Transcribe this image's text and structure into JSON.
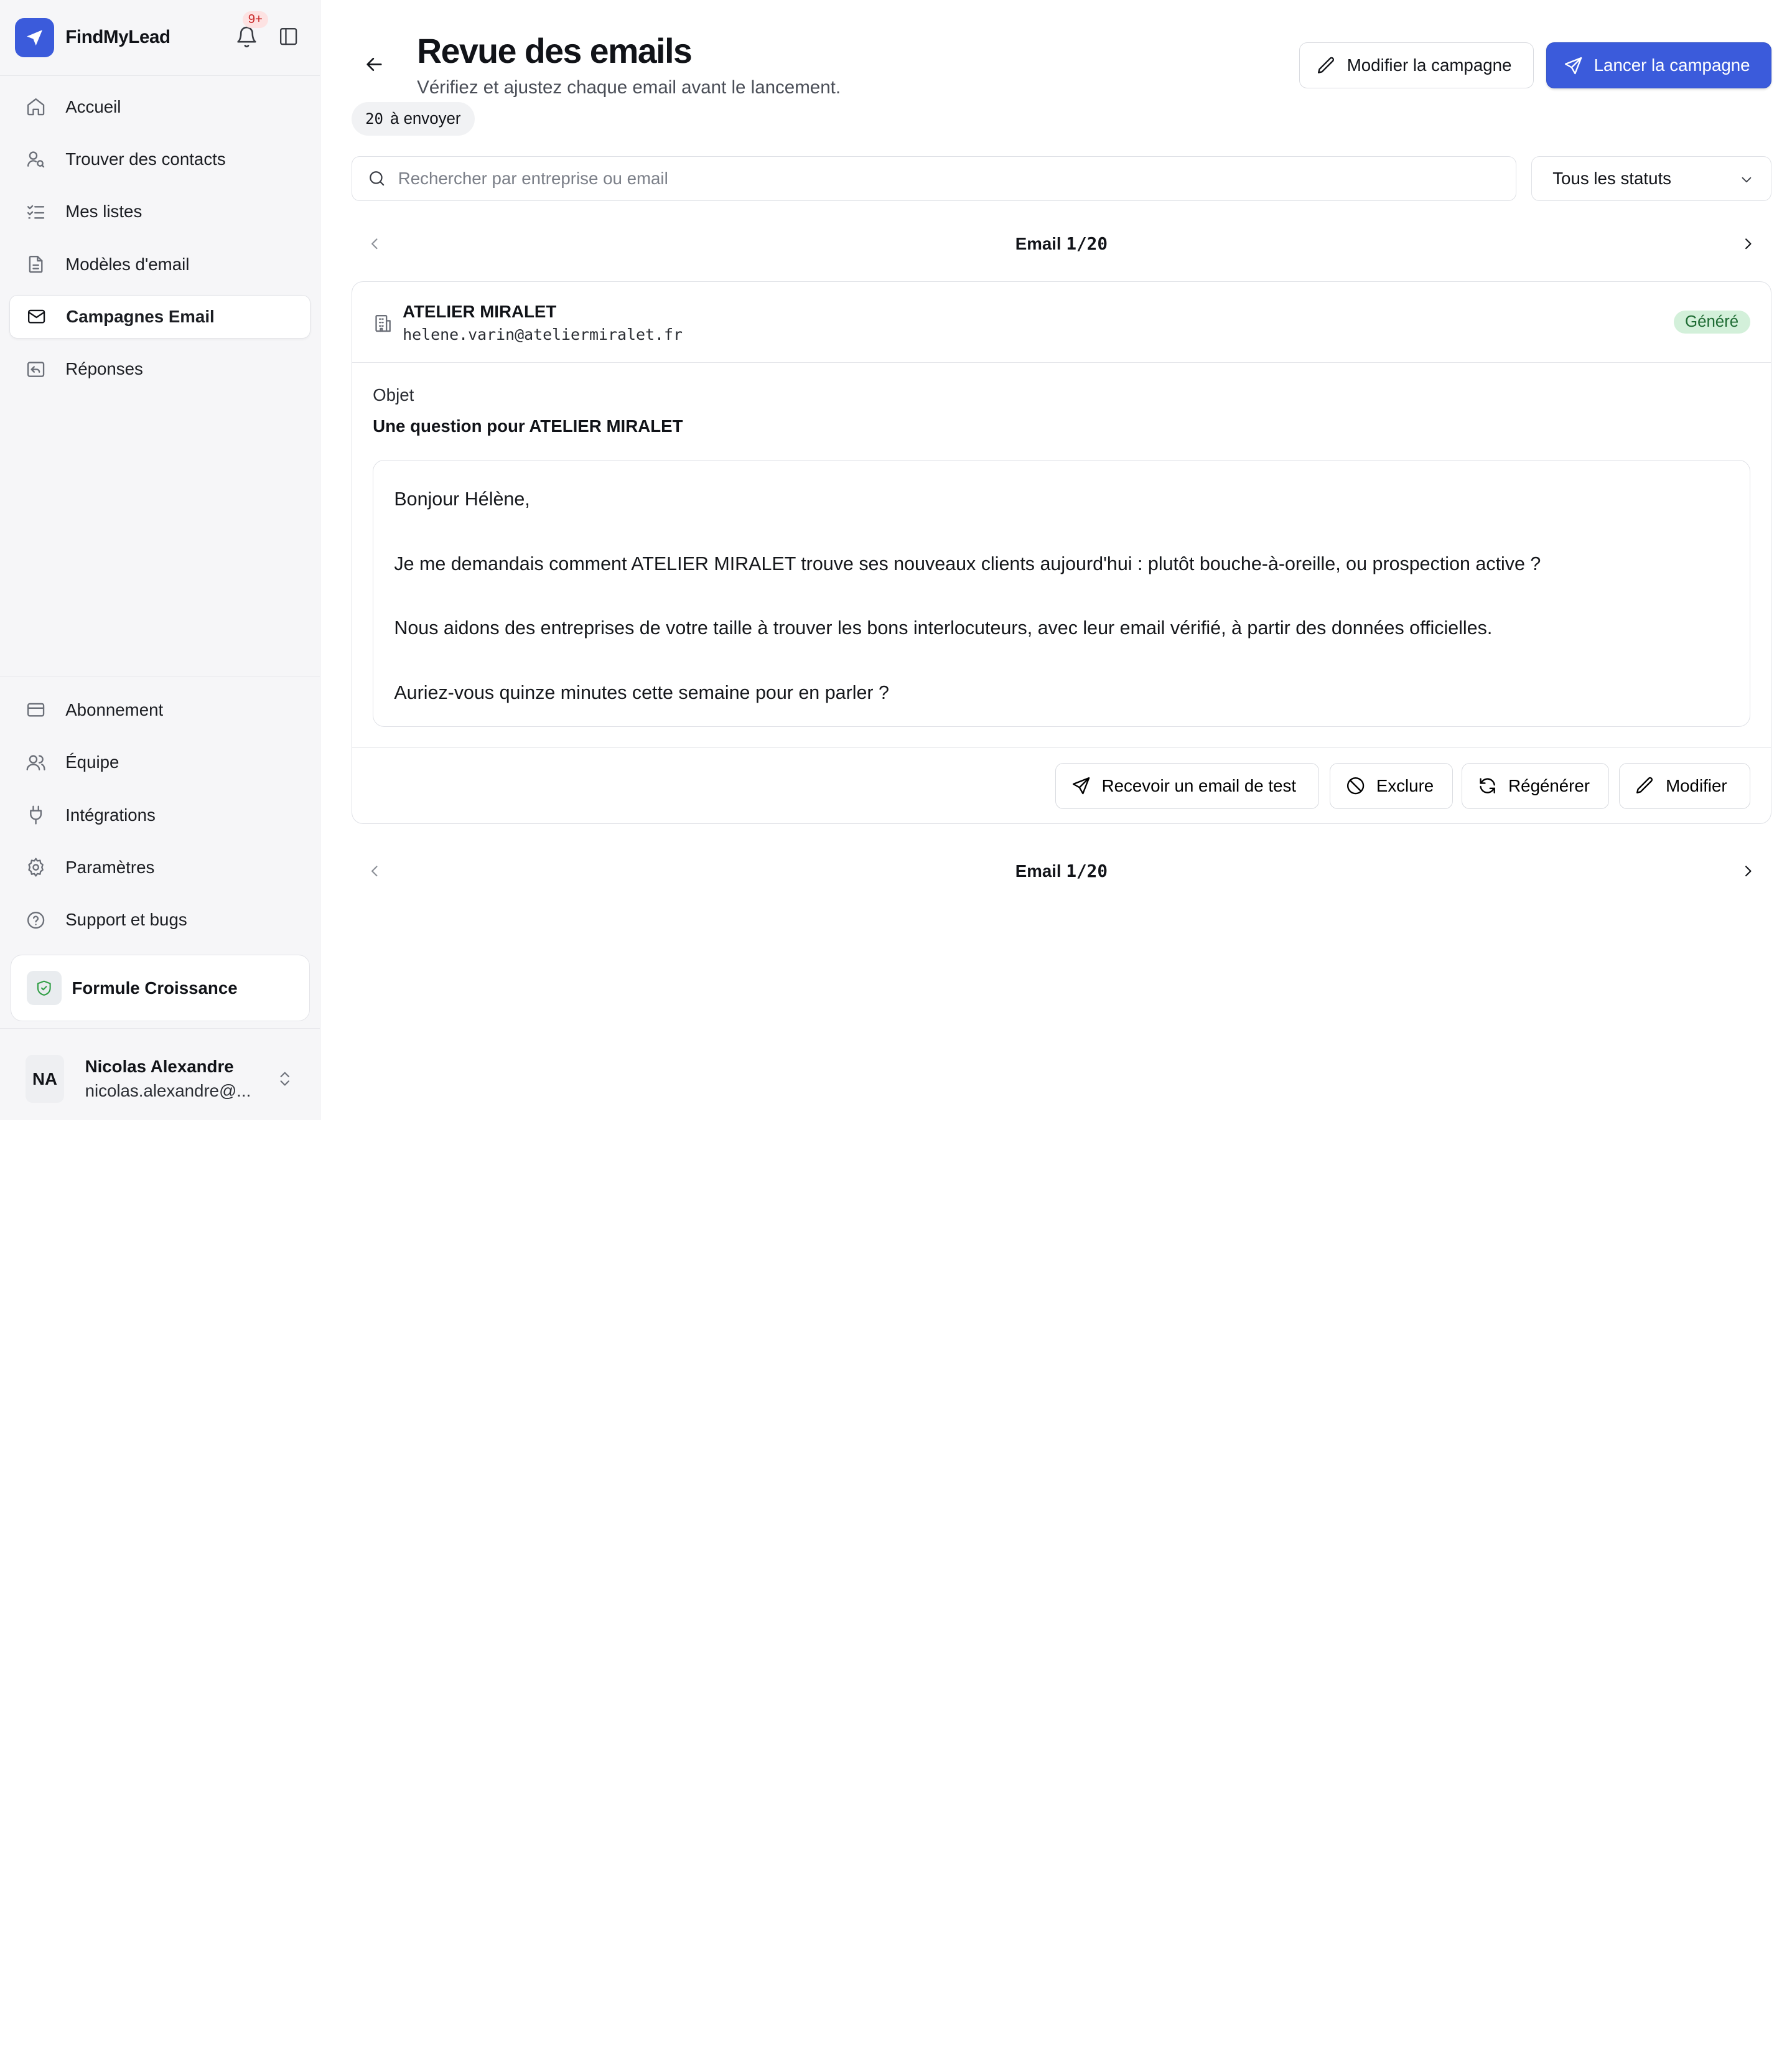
{
  "app": {
    "brand": "FindMyLead",
    "notifications": "9+"
  },
  "colors": {
    "accent": "#3b5bdb",
    "status_success_bg": "#d3f0da",
    "status_success_text": "#1e6b33",
    "notif_badge_bg": "#fde2e2"
  },
  "sidebar": {
    "items": [
      {
        "label": "Accueil",
        "icon": "home-icon"
      },
      {
        "label": "Trouver des contacts",
        "icon": "user-search-icon"
      },
      {
        "label": "Mes listes",
        "icon": "list-check-icon"
      },
      {
        "label": "Modèles d'email",
        "icon": "file-text-icon"
      },
      {
        "label": "Campagnes Email",
        "icon": "mail-icon",
        "active": true
      },
      {
        "label": "Réponses",
        "icon": "reply-icon"
      }
    ],
    "bottom_items": [
      {
        "label": "Abonnement",
        "icon": "credit-card-icon"
      },
      {
        "label": "Équipe",
        "icon": "users-icon"
      },
      {
        "label": "Intégrations",
        "icon": "plug-icon"
      },
      {
        "label": "Paramètres",
        "icon": "gear-icon"
      },
      {
        "label": "Support et bugs",
        "icon": "help-circle-icon"
      }
    ],
    "plan": {
      "label": "Formule Croissance",
      "icon": "shield-check-icon"
    },
    "user": {
      "initials": "NA",
      "name": "Nicolas Alexandre",
      "email": "nicolas.alexandre@..."
    }
  },
  "header": {
    "title": "Revue des emails",
    "subtitle": "Vérifiez et ajustez chaque email avant le lancement.",
    "count": "20",
    "count_label": "à envoyer",
    "edit_campaign": "Modifier la campagne",
    "launch_campaign": "Lancer la campagne"
  },
  "filters": {
    "search_placeholder": "Rechercher par entreprise ou email",
    "status_select": "Tous les statuts"
  },
  "pager": {
    "label": "Email",
    "position": "1/20"
  },
  "email": {
    "company": "ATELIER MIRALET",
    "address": "helene.varin@ateliermiralet.fr",
    "status": "Généré",
    "subject_label": "Objet",
    "subject": "Une question pour ATELIER MIRALET",
    "body": [
      "Bonjour Hélène,",
      "Je me demandais comment ATELIER MIRALET trouve ses nouveaux clients aujourd'hui : plutôt bouche-à-oreille, ou prospection active ?",
      "Nous aidons des entreprises de votre taille à trouver les bons interlocuteurs, avec leur email vérifié, à partir des données officielles.",
      "Auriez-vous quinze minutes cette semaine pour en parler ?"
    ],
    "actions": {
      "test": "Recevoir un email de test",
      "exclude": "Exclure",
      "regenerate": "Régénérer",
      "edit": "Modifier"
    }
  }
}
